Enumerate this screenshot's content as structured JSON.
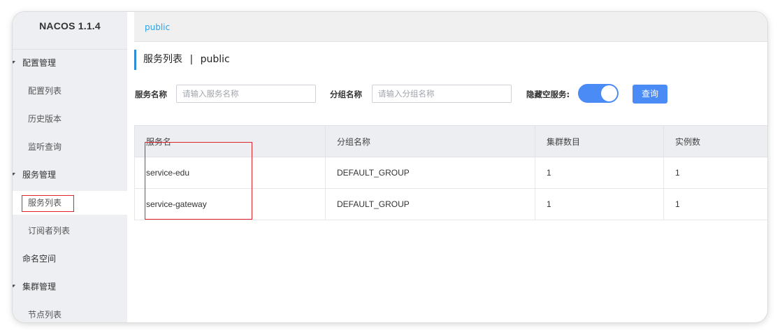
{
  "app": {
    "title": "NACOS 1.1.4"
  },
  "sidebar": {
    "items": [
      {
        "label": "配置管理",
        "type": "group"
      },
      {
        "label": "配置列表",
        "type": "sub"
      },
      {
        "label": "历史版本",
        "type": "sub"
      },
      {
        "label": "监听查询",
        "type": "sub"
      },
      {
        "label": "服务管理",
        "type": "group"
      },
      {
        "label": "服务列表",
        "type": "sub",
        "active": true
      },
      {
        "label": "订阅者列表",
        "type": "sub"
      },
      {
        "label": "命名空间",
        "type": "item"
      },
      {
        "label": "集群管理",
        "type": "group"
      },
      {
        "label": "节点列表",
        "type": "sub"
      }
    ]
  },
  "topbar": {
    "namespace": "public"
  },
  "page": {
    "title": "服务列表",
    "separator": "|",
    "namespace": "public"
  },
  "filters": {
    "service_name_label": "服务名称",
    "service_name_placeholder": "请输入服务名称",
    "service_name_value": "",
    "group_name_label": "分组名称",
    "group_name_placeholder": "请输入分组名称",
    "group_name_value": "",
    "hide_empty_label": "隐藏空服务:",
    "hide_empty_on": true,
    "query_label": "查询"
  },
  "table": {
    "headers": [
      "服务名",
      "分组名称",
      "集群数目",
      "实例数"
    ],
    "rows": [
      [
        "service-edu",
        "DEFAULT_GROUP",
        "1",
        "1"
      ],
      [
        "service-gateway",
        "DEFAULT_GROUP",
        "1",
        "1"
      ]
    ]
  },
  "colors": {
    "accent": "#4a8bf5",
    "namespace_link": "#2ba3e8",
    "annotation": "#e0222a",
    "sidebar_bg": "#eeeff3"
  }
}
